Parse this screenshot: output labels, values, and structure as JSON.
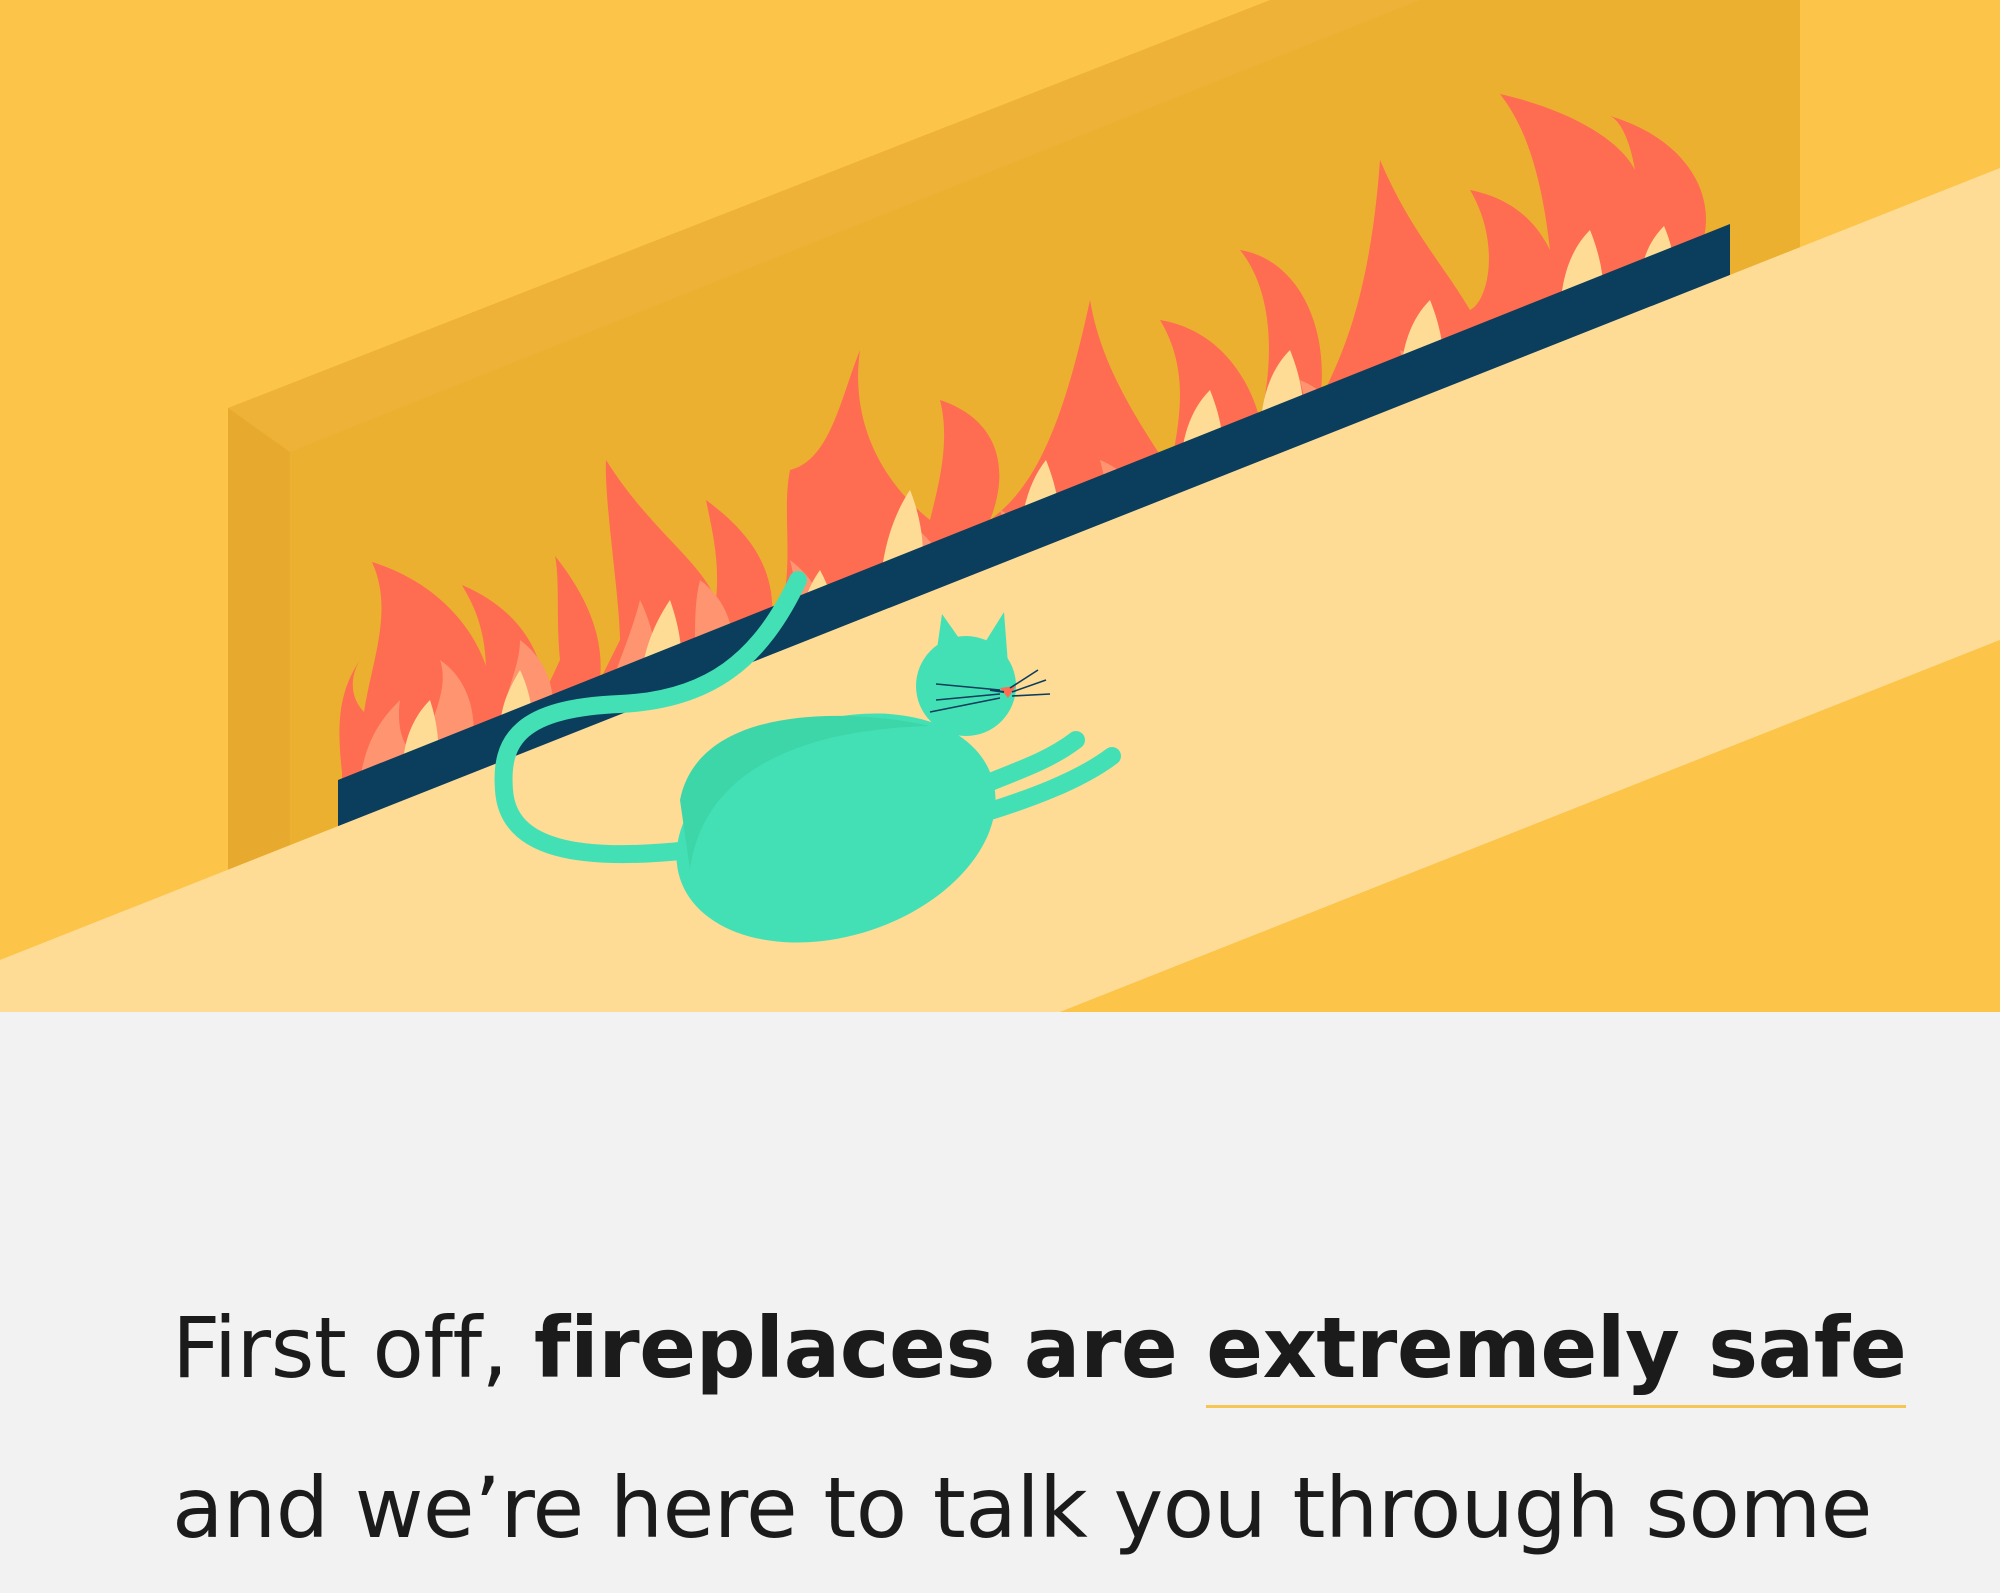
{
  "article": {
    "intro_normal_1": "First off, ",
    "intro_bold_1": "fireplaces are ",
    "intro_bold_highlight": "extremely safe",
    "intro_line_2": "and we’re here to talk you through some"
  },
  "illustration": {
    "icons": [
      "fireplace-illustration",
      "flames-icon",
      "cat-icon"
    ],
    "colors": {
      "wall": "#fcc549",
      "firebox": "#ecb335",
      "mantel": "#fedc96",
      "grate": "#0b3d5c",
      "flame_outer": "#fe6c52",
      "flame_inner": "#fe9470",
      "flame_core": "#fedc96",
      "cat": "#44e0b5",
      "text": "#1b1b1b",
      "underline": "#f6c552"
    }
  }
}
